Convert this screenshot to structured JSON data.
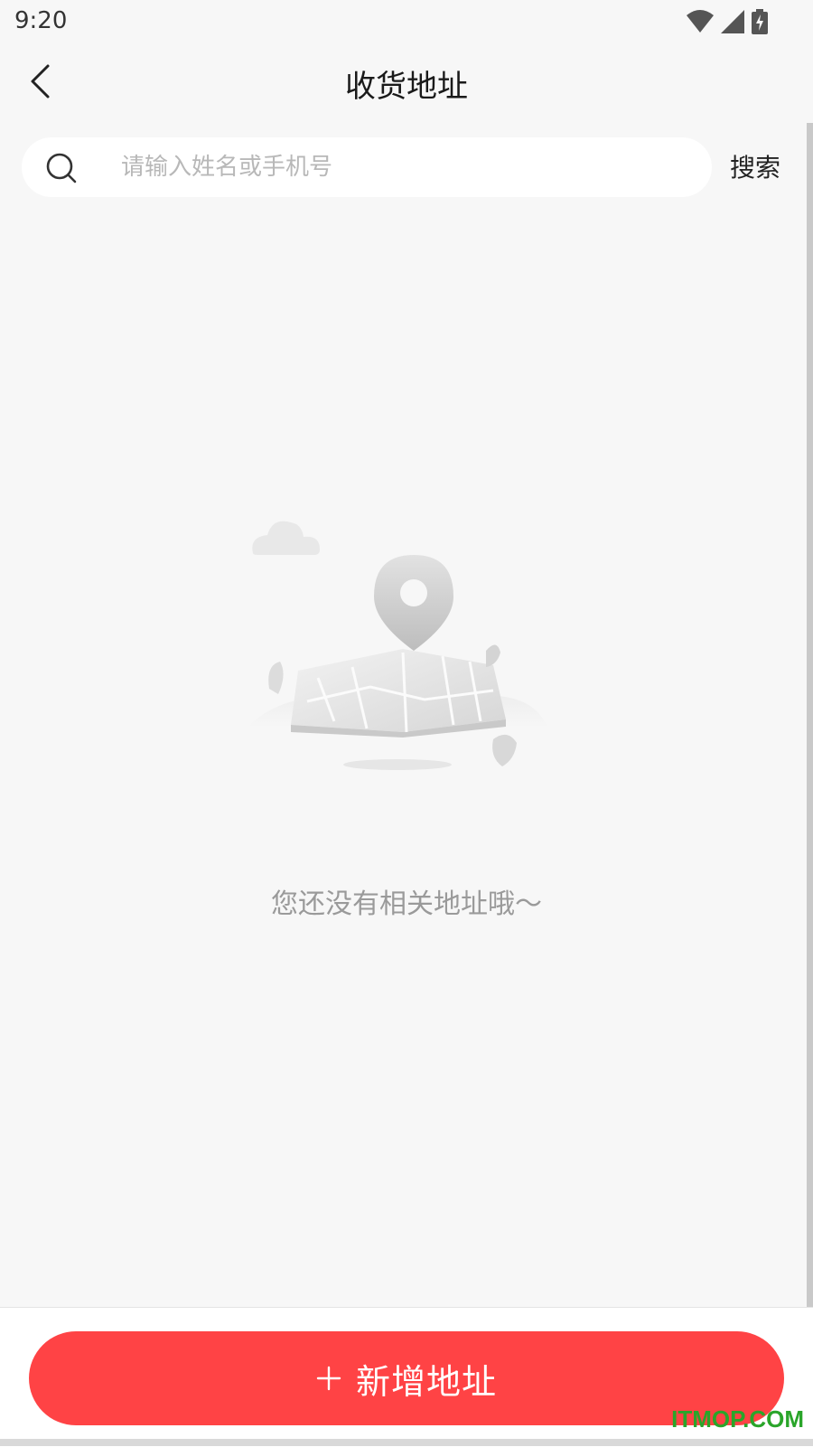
{
  "status_bar": {
    "time": "9:20",
    "icons": [
      "wifi-icon",
      "cellular-signal-icon",
      "battery-charging-icon"
    ]
  },
  "header": {
    "title": "收货地址",
    "back_icon": "chevron-left-icon"
  },
  "search": {
    "placeholder": "请输入姓名或手机号",
    "value": "",
    "icon": "search-icon",
    "button_label": "搜索"
  },
  "empty_state": {
    "illustration": "map-pin-illustration",
    "message": "您还没有相关地址哦～"
  },
  "footer": {
    "add_button_icon": "plus-icon",
    "add_button_label": "新增地址"
  },
  "watermark": "ITMOP.COM",
  "colors": {
    "accent": "#ff4345",
    "background": "#f7f7f7",
    "placeholder": "#b8b8b8",
    "muted_text": "#9a9a9a"
  }
}
